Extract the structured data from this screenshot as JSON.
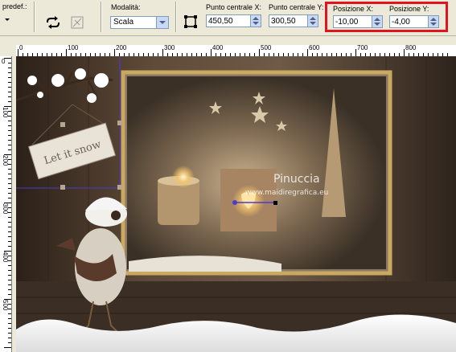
{
  "toolbar": {
    "preset_label": "predef.:",
    "mode_label": "Modalità:",
    "mode_value": "Scala",
    "center_x_label": "Punto centrale X:",
    "center_x_value": "450,50",
    "center_y_label": "Punto centrale Y:",
    "center_y_value": "300,50",
    "pos_x_label": "Posizione X:",
    "pos_x_value": "-10,00",
    "pos_y_label": "Posizione Y:",
    "pos_y_value": "-4,00"
  },
  "ruler": {
    "h_labels": [
      "0",
      "100",
      "200",
      "300",
      "400",
      "500",
      "600",
      "700",
      "800"
    ],
    "v_labels": [
      "0",
      "100",
      "200",
      "300",
      "400",
      "500"
    ]
  },
  "canvas": {
    "sign_text": "Let it snow",
    "watermark_title": "Pinuccia",
    "watermark_url": "www.maidiregrafica.eu"
  },
  "colors": {
    "highlight": "#e0131f",
    "frame_gold": "#c9a860",
    "selection": "#4a3ccc"
  }
}
